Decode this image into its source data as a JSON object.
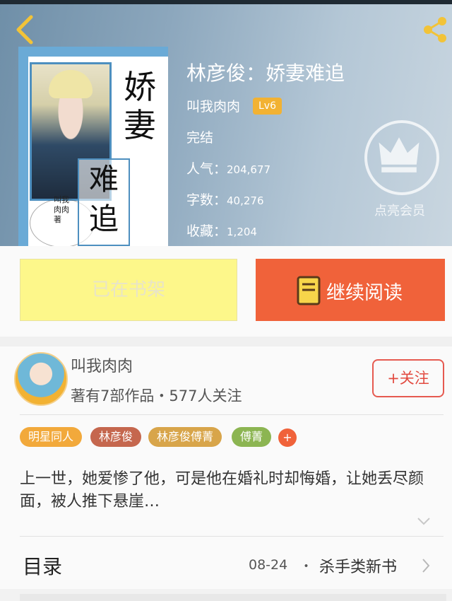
{
  "header": {
    "back_icon": "chevron-left-icon",
    "share_icon": "share-icon"
  },
  "cover": {
    "title_top": "娇妻",
    "title_bottom": "难追",
    "author_text": "叫我肉肉著"
  },
  "book": {
    "title": "林彦俊：娇妻难追",
    "author": "叫我肉肉",
    "level": "Lv6",
    "status": "完结",
    "popularity_label": "人气：",
    "popularity_value": "204,677",
    "words_label": "字数：",
    "words_value": "40,276",
    "favorites_label": "收藏：",
    "favorites_value": "1,204"
  },
  "vip": {
    "icon": "crown-icon",
    "label": "点亮会员"
  },
  "actions": {
    "shelf_label": "已在书架",
    "read_label": "继续阅读",
    "read_icon": "book-icon"
  },
  "author_card": {
    "name": "叫我肉肉",
    "info": "著有7部作品・577人关注",
    "follow_label": "+关注"
  },
  "tags": [
    {
      "label": "明星同人",
      "color": "#f2a93b"
    },
    {
      "label": "林彦俊",
      "color": "#c5674e"
    },
    {
      "label": "林彦俊傅菁",
      "color": "#d8a54a"
    },
    {
      "label": "傅菁",
      "color": "#8cb552"
    }
  ],
  "tag_add_label": "+",
  "description": "上一世，她爱惨了他，可是他在婚礼时却悔婚，让她丢尽颜面，被人推下悬崖…",
  "toc": {
    "title": "目录",
    "date": "08-24",
    "dot": "・",
    "latest": "杀手类新书"
  },
  "colors": {
    "accent": "#f0623a",
    "shelf": "#fdf78a",
    "level": "#f2b233",
    "follow": "#e24a40"
  }
}
